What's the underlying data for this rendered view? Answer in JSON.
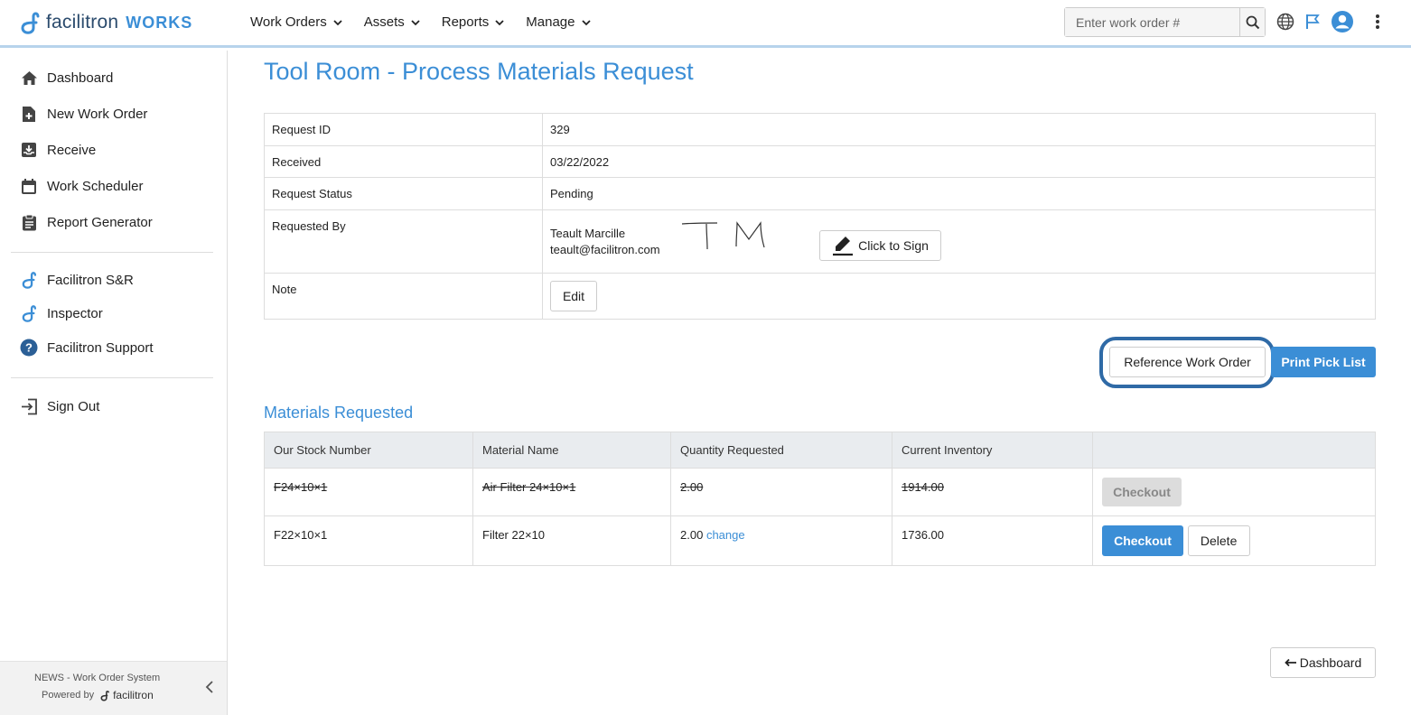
{
  "header": {
    "brand": "facilitron",
    "brand_suffix": "WORKS",
    "nav": [
      {
        "label": "Work Orders"
      },
      {
        "label": "Assets"
      },
      {
        "label": "Reports"
      },
      {
        "label": "Manage"
      }
    ],
    "search": {
      "placeholder": "Enter work order #",
      "value": ""
    },
    "icons": [
      "search-icon",
      "globe-icon",
      "flag-icon",
      "user-avatar-icon",
      "more-vertical-icon"
    ]
  },
  "sidebar": {
    "items": [
      {
        "label": "Dashboard",
        "icon": "home-icon"
      },
      {
        "label": "New Work Order",
        "icon": "file-plus-icon"
      },
      {
        "label": "Receive",
        "icon": "inbox-icon"
      },
      {
        "label": "Work Scheduler",
        "icon": "calendar-icon"
      },
      {
        "label": "Report Generator",
        "icon": "clipboard-icon"
      }
    ],
    "links": [
      {
        "label": "Facilitron S&R",
        "icon": "facilitron-icon"
      },
      {
        "label": "Inspector",
        "icon": "facilitron-icon"
      },
      {
        "label": "Facilitron Support",
        "icon": "help-icon"
      }
    ],
    "sign_out": {
      "label": "Sign Out",
      "icon": "sign-out-icon"
    },
    "footer": {
      "system": "NEWS - Work Order System",
      "powered_by": "Powered by",
      "powered_brand": "facilitron"
    }
  },
  "page": {
    "title": "Tool Room - Process Materials Request",
    "info": {
      "request_id_label": "Request ID",
      "request_id": "329",
      "received_label": "Received",
      "received": "03/22/2022",
      "status_label": "Request Status",
      "status": "Pending",
      "requested_by_label": "Requested By",
      "requester_name": "Teault Marcille",
      "requester_email": "teault@facilitron.com",
      "signature_text": "TM",
      "click_to_sign": "Click to Sign",
      "note_label": "Note",
      "edit_label": "Edit"
    },
    "actions": {
      "reference_work_order": "Reference Work Order",
      "print_pick_list": "Print Pick List"
    },
    "materials": {
      "title": "Materials Requested",
      "columns": [
        "Our Stock Number",
        "Material Name",
        "Quantity Requested",
        "Current Inventory",
        ""
      ],
      "rows": [
        {
          "stock_number": "F24×10×1",
          "material_name": "Air Filter 24×10×1",
          "quantity": "2.00",
          "inventory": "1914.00",
          "checkout": "Checkout",
          "struck": true
        },
        {
          "stock_number": "F22×10×1",
          "material_name": "Filter 22×10",
          "quantity": "2.00",
          "change": "change",
          "inventory": "1736.00",
          "checkout": "Checkout",
          "delete": "Delete",
          "struck": false
        }
      ]
    },
    "back_button": "Dashboard",
    "colors": {
      "accent": "#3b8ed6",
      "brand_dark": "#2b4b6d",
      "highlight_ring": "#2f6aa6"
    }
  }
}
